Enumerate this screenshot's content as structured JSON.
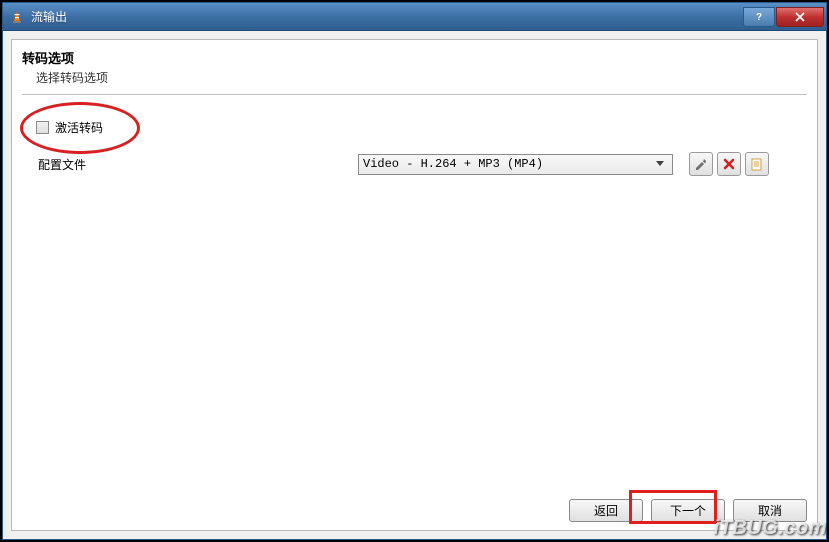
{
  "titlebar": {
    "title": "流输出"
  },
  "section": {
    "title": "转码选项",
    "subtitle": "选择转码选项"
  },
  "checkbox": {
    "label": "激活转码"
  },
  "profile": {
    "label": "配置文件",
    "selected": "Video - H.264 + MP3 (MP4)"
  },
  "icons": {
    "wrench": "wrench-icon",
    "delete": "delete-icon",
    "new": "new-icon"
  },
  "buttons": {
    "back": "返回",
    "next": "下一个",
    "cancel": "取消"
  },
  "watermark": "iTBUG.com"
}
